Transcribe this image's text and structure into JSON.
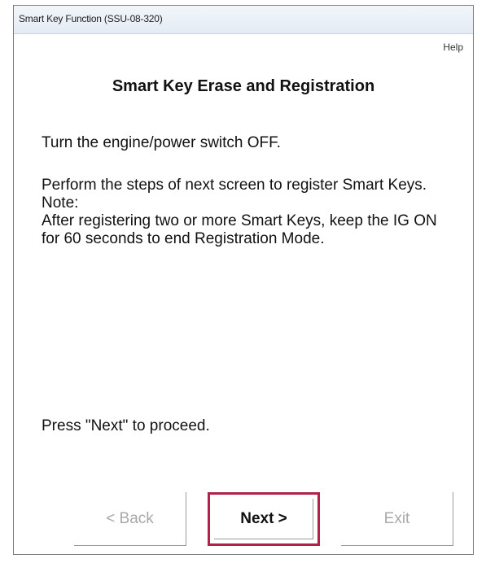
{
  "window": {
    "title": "Smart Key Function (SSU-08-320)"
  },
  "header": {
    "help_label": "Help",
    "heading": "Smart Key Erase and Registration"
  },
  "instructions": {
    "line1": "Turn the engine/power switch OFF.",
    "line2": "Perform the steps of next screen to register Smart Keys.",
    "note_label": "Note:",
    "note_text": "After registering two or more Smart Keys, keep the IG ON for 60 seconds to end Registration Mode.",
    "proceed": "Press \"Next\" to proceed."
  },
  "buttons": {
    "back_label": "< Back",
    "next_label": "Next >",
    "exit_label": "Exit"
  },
  "colors": {
    "highlight": "#b0224a",
    "disabled_text": "#a8a8a8"
  }
}
